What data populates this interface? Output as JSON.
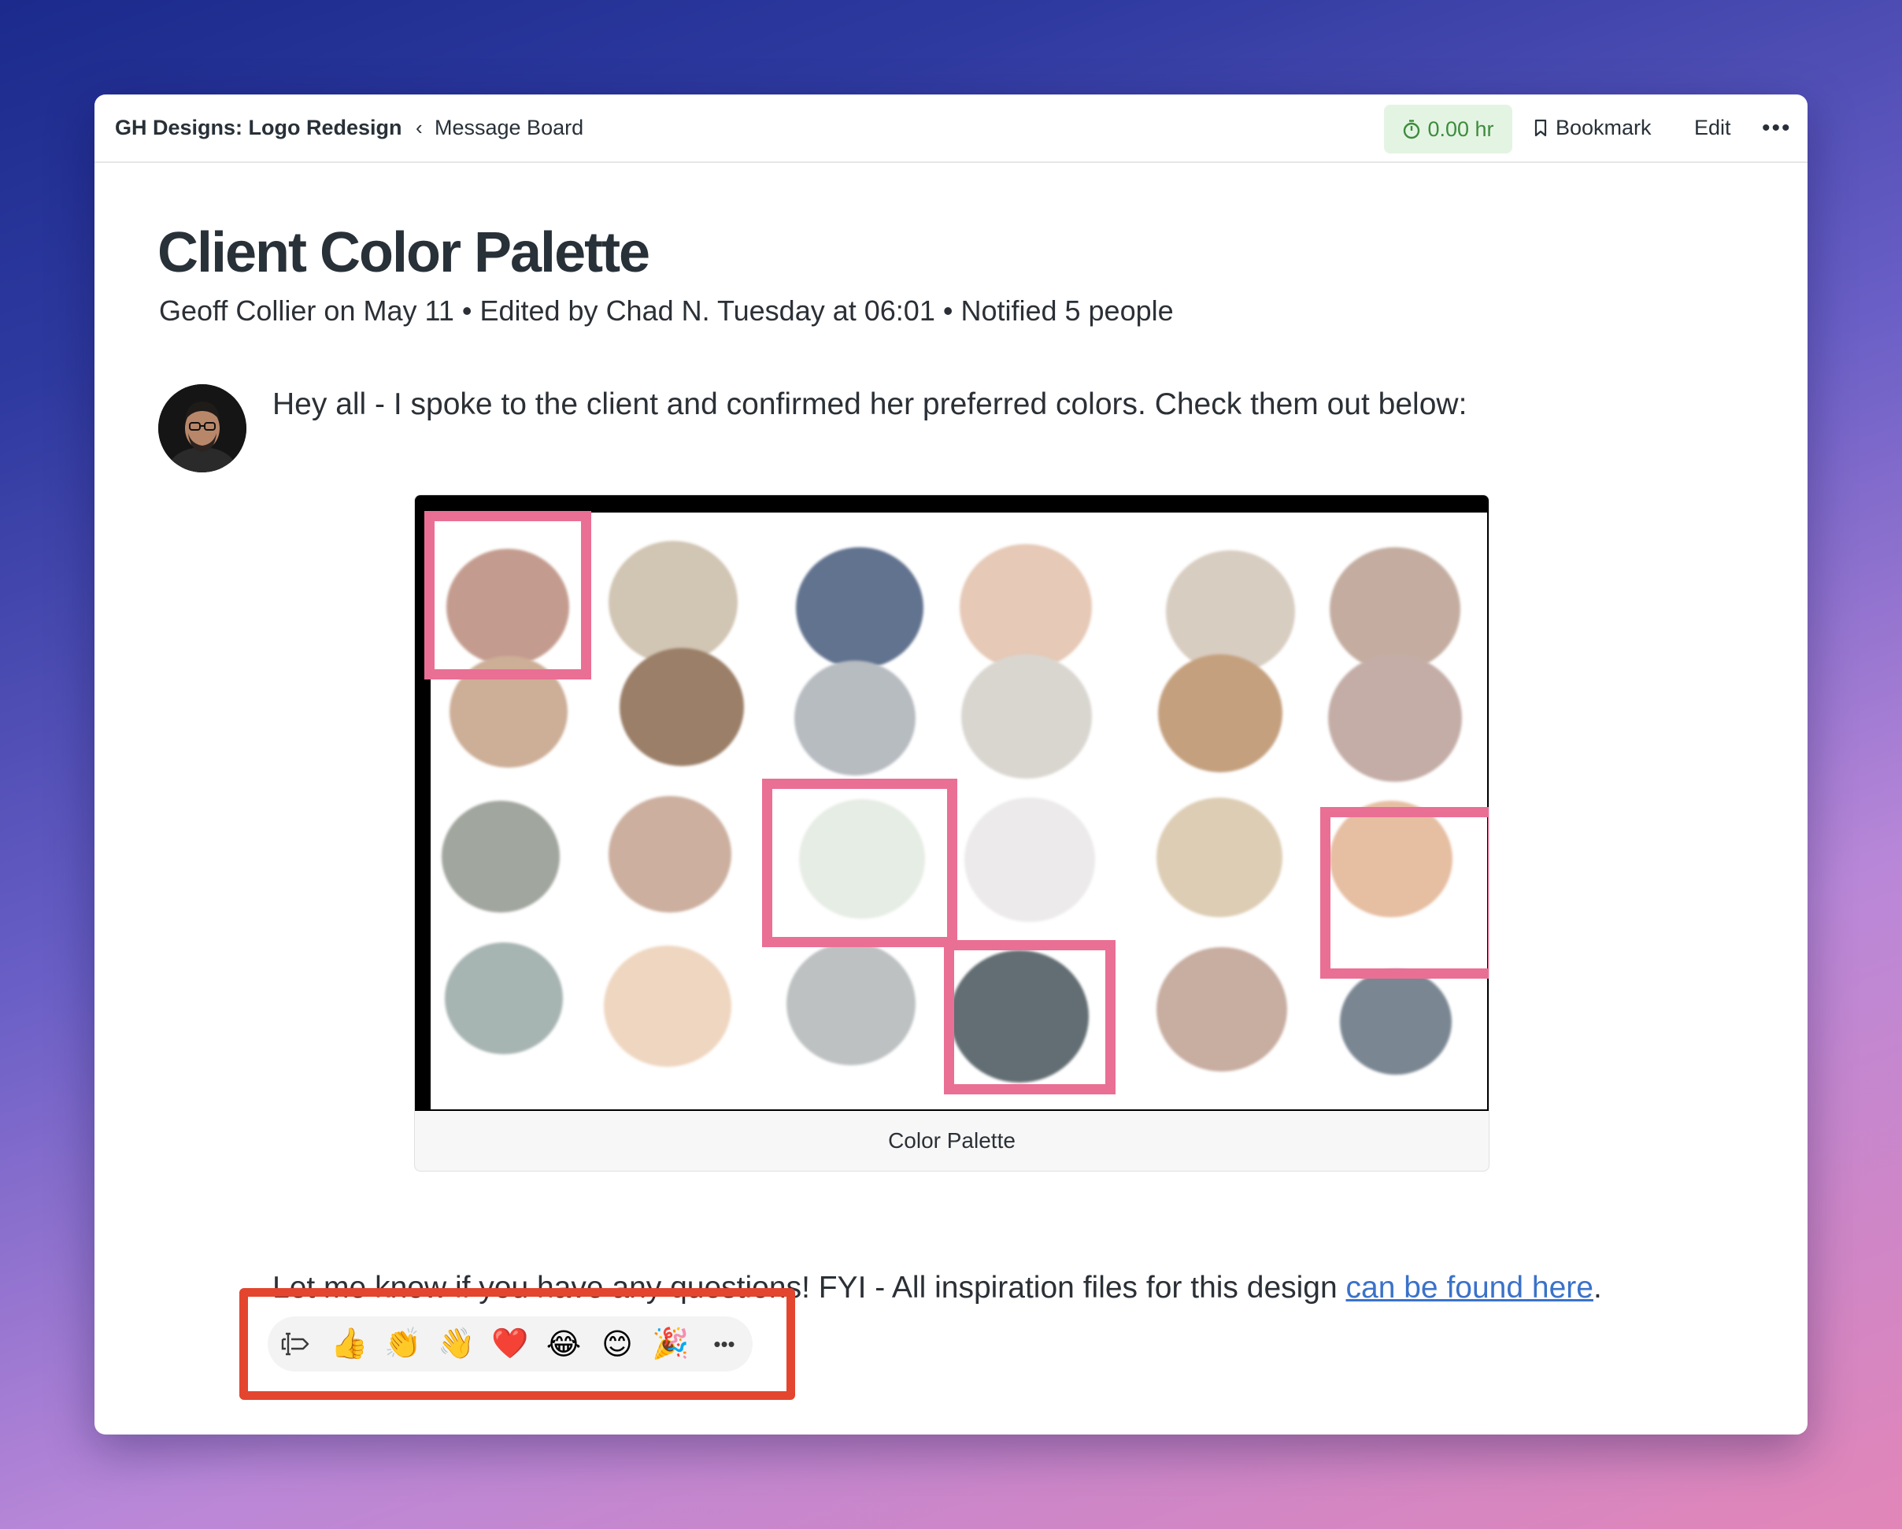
{
  "breadcrumb": {
    "project": "GH Designs: Logo Redesign",
    "separator": "‹",
    "board": "Message Board"
  },
  "toolbar": {
    "timer": "0.00 hr",
    "bookmark": "Bookmark",
    "edit": "Edit",
    "more": "•••"
  },
  "message": {
    "title": "Client Color Palette",
    "meta": "Geoff Collier on May 11 • Edited by Chad N. Tuesday at 06:01 • Notified 5 people",
    "intro": "Hey all - I spoke to the client and confirmed her preferred colors. Check them out below:",
    "image_caption": "Color Palette",
    "body_before_link": "Let me know if you have any questions! FYI - All inspiration files for this design ",
    "link_text": "can be found here",
    "body_after_link": "."
  },
  "palette": {
    "swatch_colors": [
      "#c49c8f",
      "#d1c5b3",
      "#627390",
      "#e6c9b6",
      "#d8cdc1",
      "#c4ada0",
      "#cdae97",
      "#9b7f68",
      "#b7bcc1",
      "#d9d6d0",
      "#c4a07e",
      "#c4ada6",
      "#a1a69e",
      "#ccaf9f",
      "#e6ede4",
      "#eceaea",
      "#ddcdb4",
      "#e6bea2",
      "#a6b4b2",
      "#efd6c0",
      "#bdc1c2",
      "#626e73",
      "#c8ada1",
      "#7a8793"
    ],
    "highlight_color": "#ea6f95"
  },
  "reactions": {
    "items": [
      {
        "name": "thumbs-up-icon",
        "glyph": "👍"
      },
      {
        "name": "clapping-hands-icon",
        "glyph": "👏"
      },
      {
        "name": "waving-hand-icon",
        "glyph": "👋"
      },
      {
        "name": "heart-icon",
        "glyph": "❤️"
      },
      {
        "name": "tears-of-joy-icon",
        "glyph": "😂"
      },
      {
        "name": "smiling-face-icon",
        "glyph": "😊"
      },
      {
        "name": "party-popper-icon",
        "glyph": "🎉"
      }
    ],
    "more": "•••",
    "highlight_color": "#e3452e"
  },
  "colors": {
    "timer_bg": "#e4f4e3",
    "timer_text": "#3d8c3d",
    "link": "#3a72c9",
    "text": "#2b3036"
  }
}
